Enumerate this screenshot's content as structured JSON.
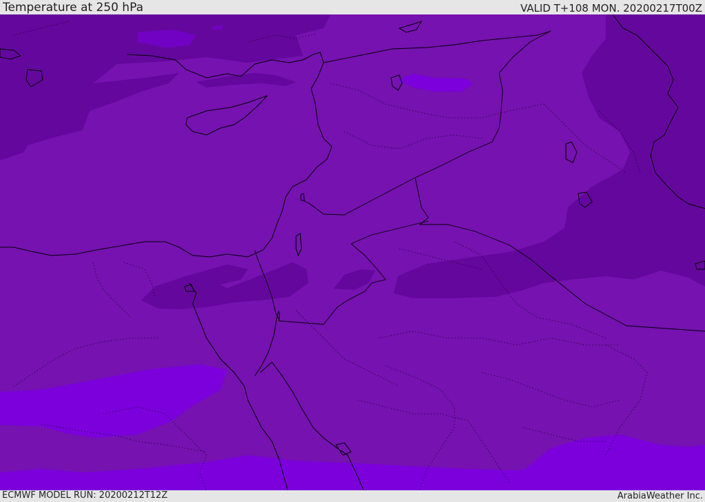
{
  "header": {
    "title": "Temperature at 250 hPa",
    "valid": "VALID T+108 MON. 20200217T00Z"
  },
  "footer": {
    "model_run": "ECMWF MODEL RUN: 20200212T12Z",
    "credit": "ArabiaWeather Inc."
  },
  "colors": {
    "base": "#7512b0",
    "dark": "#64079d",
    "bright": "#7b00dc",
    "outline": "#000000",
    "bar": "#e6e6e6"
  }
}
